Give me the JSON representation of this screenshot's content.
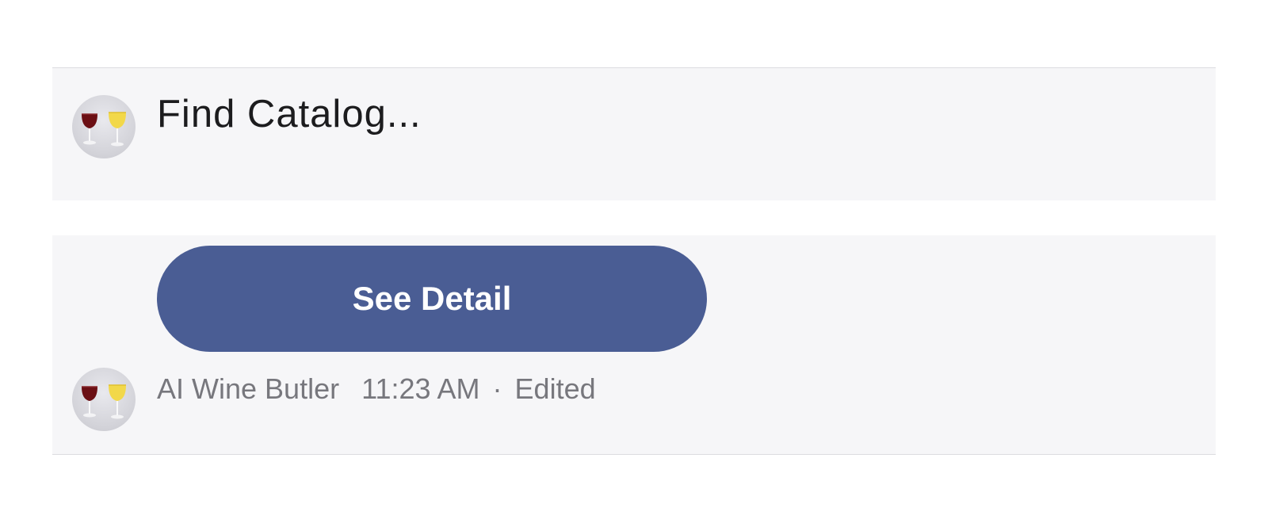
{
  "messages": [
    {
      "text": "Find Catalog...",
      "avatar_icon": "wine-glasses-icon"
    },
    {
      "button_label": "See Detail",
      "sender": "AI Wine Butler",
      "time": "11:23 AM",
      "separator": "·",
      "status": "Edited",
      "avatar_icon": "wine-glasses-icon"
    }
  ],
  "colors": {
    "button_bg": "#4a5d94",
    "bubble_bg": "#f6f6f8",
    "meta_text": "#77777d"
  }
}
